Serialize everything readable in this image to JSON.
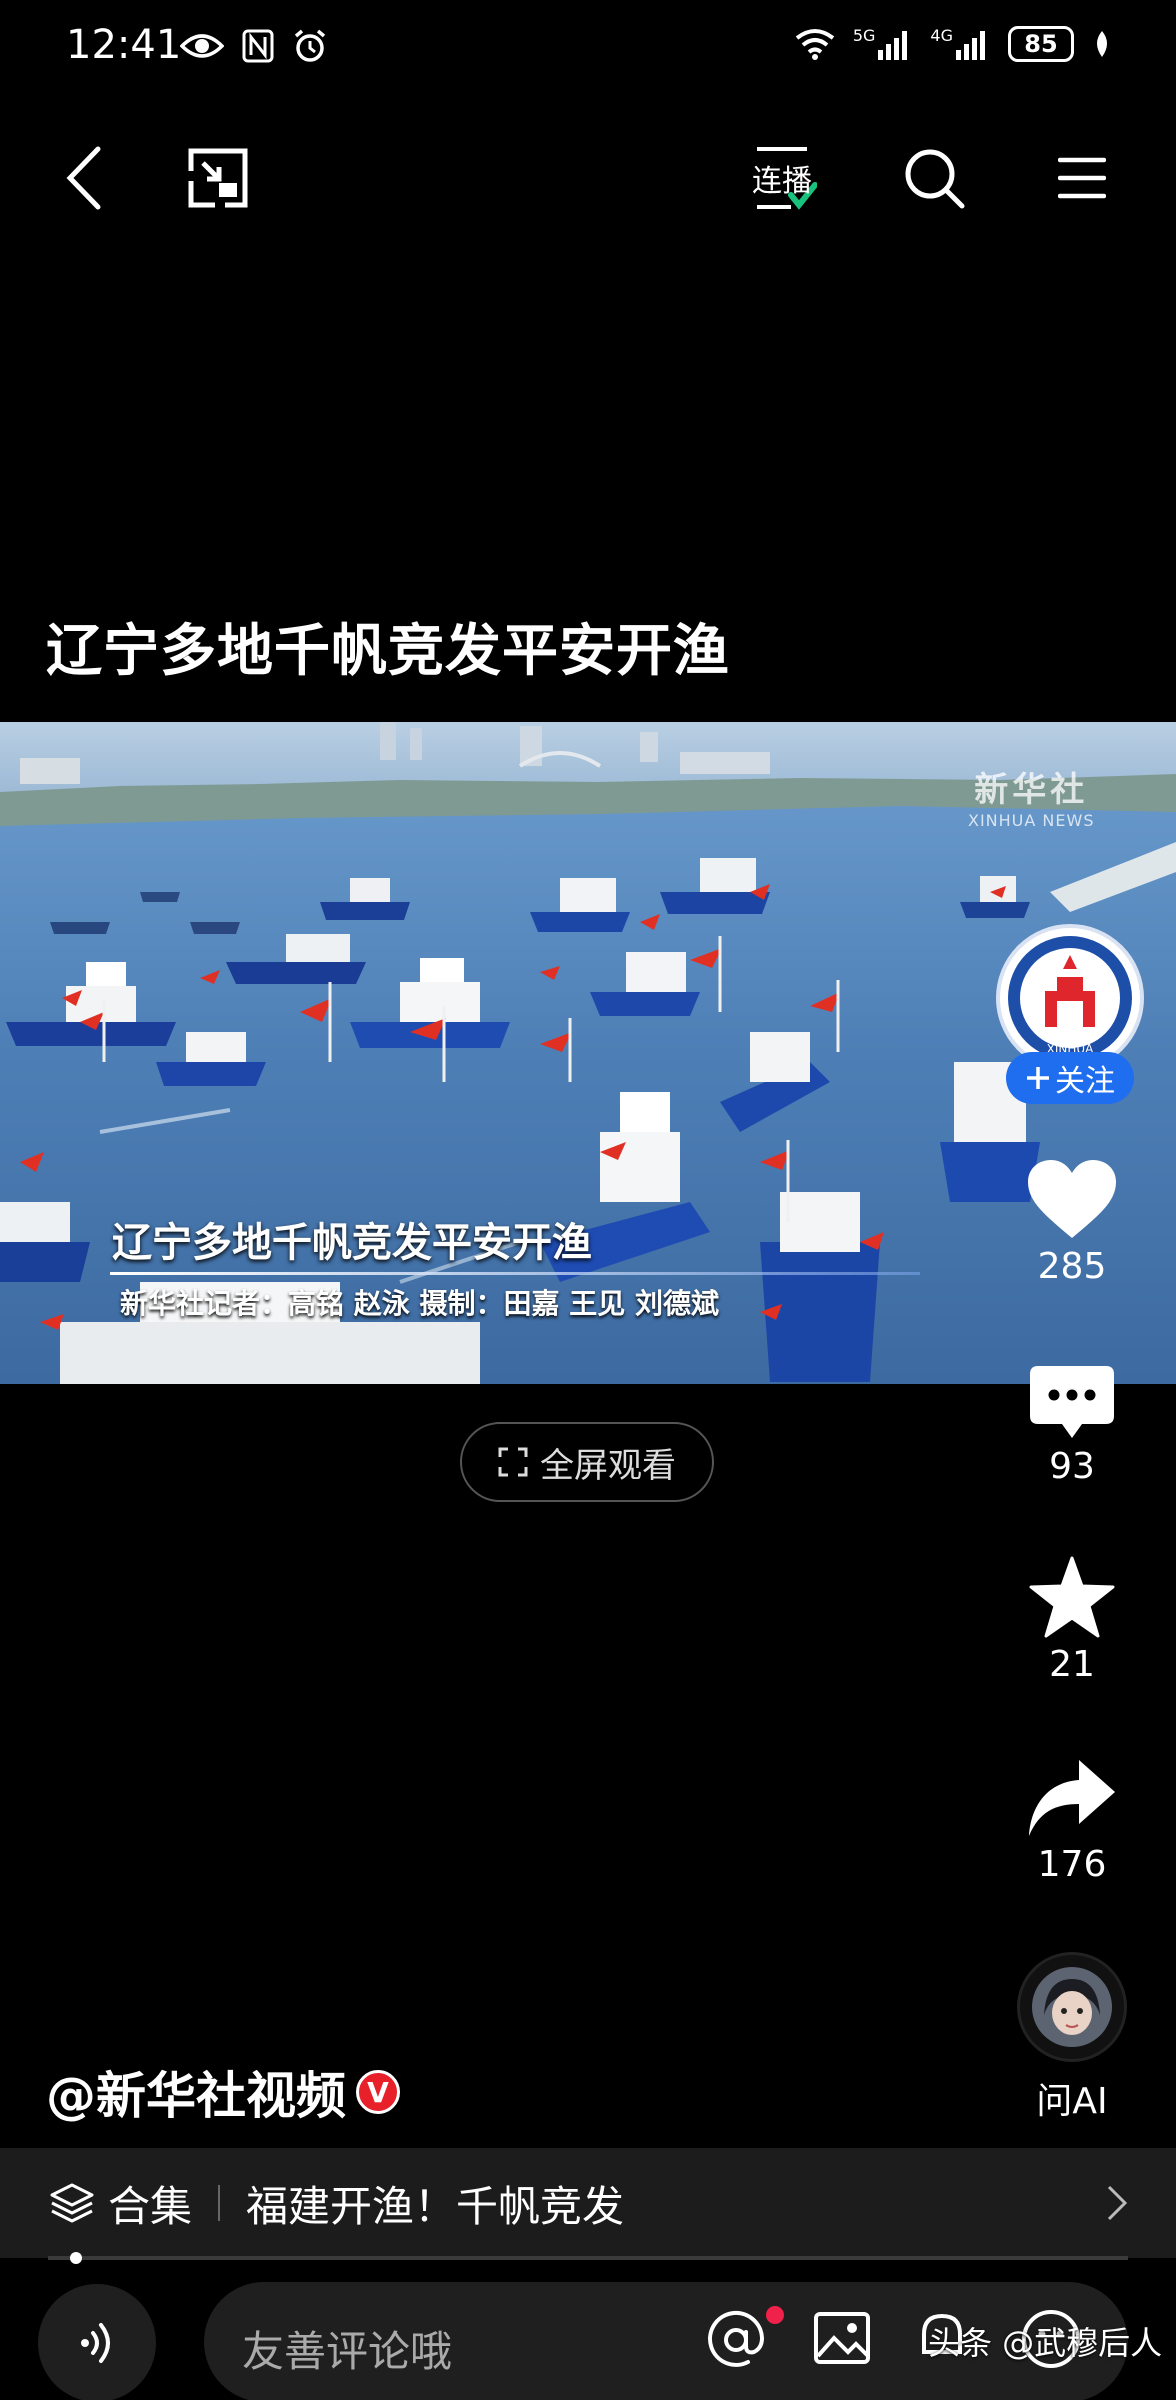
{
  "status_bar": {
    "time": "12:41",
    "network1": "5G",
    "network2": "4G",
    "battery": "85"
  },
  "nav": {
    "lianbo_label": "连播"
  },
  "video": {
    "title": "辽宁多地千帆竞发平安开渔",
    "overlay_title": "辽宁多地千帆竞发平安开渔",
    "overlay_credits": "新华社记者：高铭 赵泳  摄制：田嘉 王见 刘德斌",
    "watermark_cn": "新华社",
    "watermark_en": "XINHUA NEWS",
    "fullscreen_label": "全屏观看"
  },
  "rail": {
    "follow_label": "关注",
    "avatar_text": "XINHUA",
    "likes": "285",
    "comments": "93",
    "favorites": "21",
    "shares": "176",
    "ai_label": "问AI"
  },
  "author": {
    "name": "@新华社视频",
    "badge": "V"
  },
  "collection": {
    "label": "合集",
    "name": "福建开渔！千帆竞发"
  },
  "bottom": {
    "comment_placeholder": "友善评论哦",
    "source_mark": "头条 @武穆后人"
  },
  "colors": {
    "accent_blue": "#1f6ef0",
    "badge_red": "#e8202a",
    "check_green": "#19c37d"
  }
}
